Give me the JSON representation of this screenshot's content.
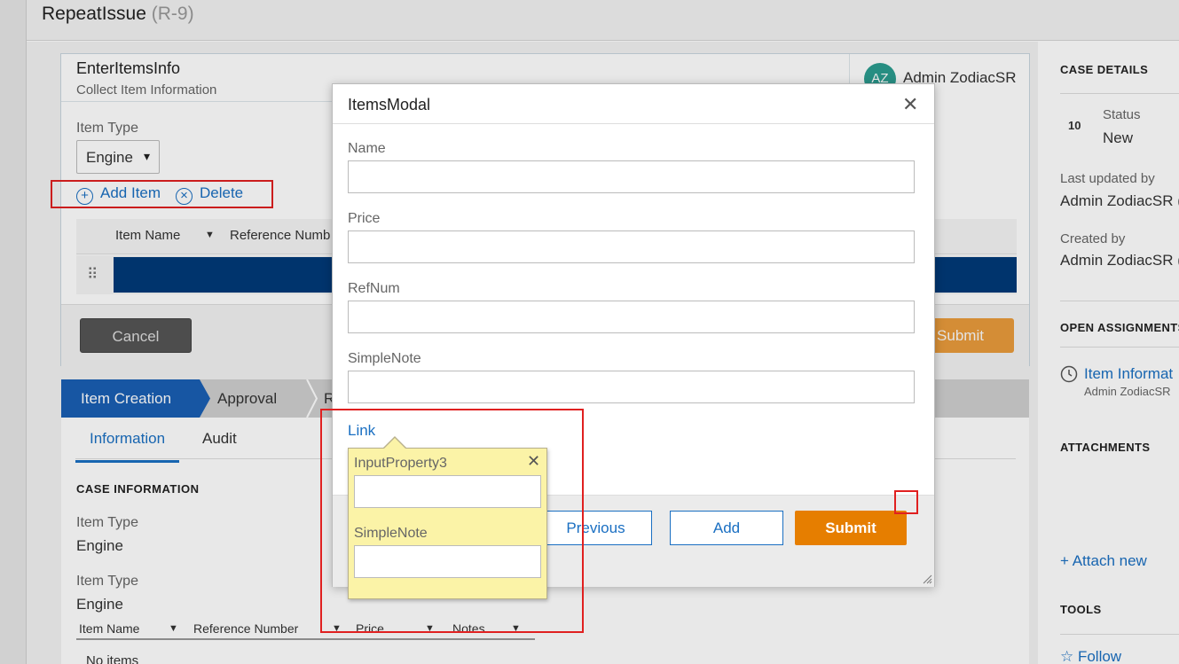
{
  "header": {
    "case_title": "RepeatIssue",
    "case_id": "(R-9)"
  },
  "assignment": {
    "title": "EnterItemsInfo",
    "subtitle": "Collect Item Information",
    "avatar_initials": "AZ",
    "user_name": "Admin ZodiacSR",
    "item_type_label": "Item Type",
    "item_type_value": "Engine",
    "item_type_arrow": "▾",
    "add_item_label": "Add Item",
    "delete_label": "Delete",
    "add_icon": "plus-circle-icon",
    "delete_icon": "x-circle-icon",
    "grid_columns": [
      "Item Name",
      "Reference Numb"
    ],
    "drag_handle": "⠿",
    "cancel_label": "Cancel",
    "submit_label": "Submit"
  },
  "stages": [
    "Item Creation",
    "Approval",
    "R"
  ],
  "lower_tabs": [
    "Information",
    "Audit"
  ],
  "case_information": {
    "heading": "CASE INFORMATION",
    "fields": [
      {
        "label": "Item Type",
        "value": "Engine"
      },
      {
        "label": "Item Type",
        "value": "Engine"
      }
    ],
    "grid_columns": [
      "Item Name",
      "Reference Number",
      "Price",
      "Notes"
    ],
    "empty_text": "No items"
  },
  "right_panel": {
    "case_details_heading": "CASE DETAILS",
    "urgency": "10",
    "status_label": "Status",
    "status_value": "New",
    "last_updated_label": "Last updated by",
    "last_updated_value": "Admin ZodiacSR (",
    "created_label": "Created by",
    "created_value": "Admin ZodiacSR (",
    "open_assignments_heading": "OPEN ASSIGNMENTS",
    "assignment_link": "Item Informat",
    "assignment_user": "Admin ZodiacSR",
    "attachments_heading": "ATTACHMENTS",
    "attach_new": "+ Attach new",
    "tools_heading": "TOOLS",
    "follow": "☆ Follow"
  },
  "modal": {
    "title": "ItemsModal",
    "close_glyph": "✕",
    "fields": [
      {
        "label": "Name",
        "value": ""
      },
      {
        "label": "Price",
        "value": ""
      },
      {
        "label": "RefNum",
        "value": ""
      },
      {
        "label": "SimpleNote",
        "value": ""
      }
    ],
    "link_label": "Link",
    "previous_label": "Previous",
    "add_label": "Add",
    "submit_label": "Submit"
  },
  "popover": {
    "close_glyph": "✕",
    "fields": [
      {
        "label": "InputProperty3",
        "value": ""
      },
      {
        "label": "SimpleNote",
        "value": ""
      }
    ]
  },
  "colors": {
    "accent_blue": "#1a6fc2",
    "stage_active": "#1a5fb4",
    "submit_orange": "#e67e00",
    "popover_yellow": "#fbf3a7",
    "annotation_red": "#e02020"
  }
}
